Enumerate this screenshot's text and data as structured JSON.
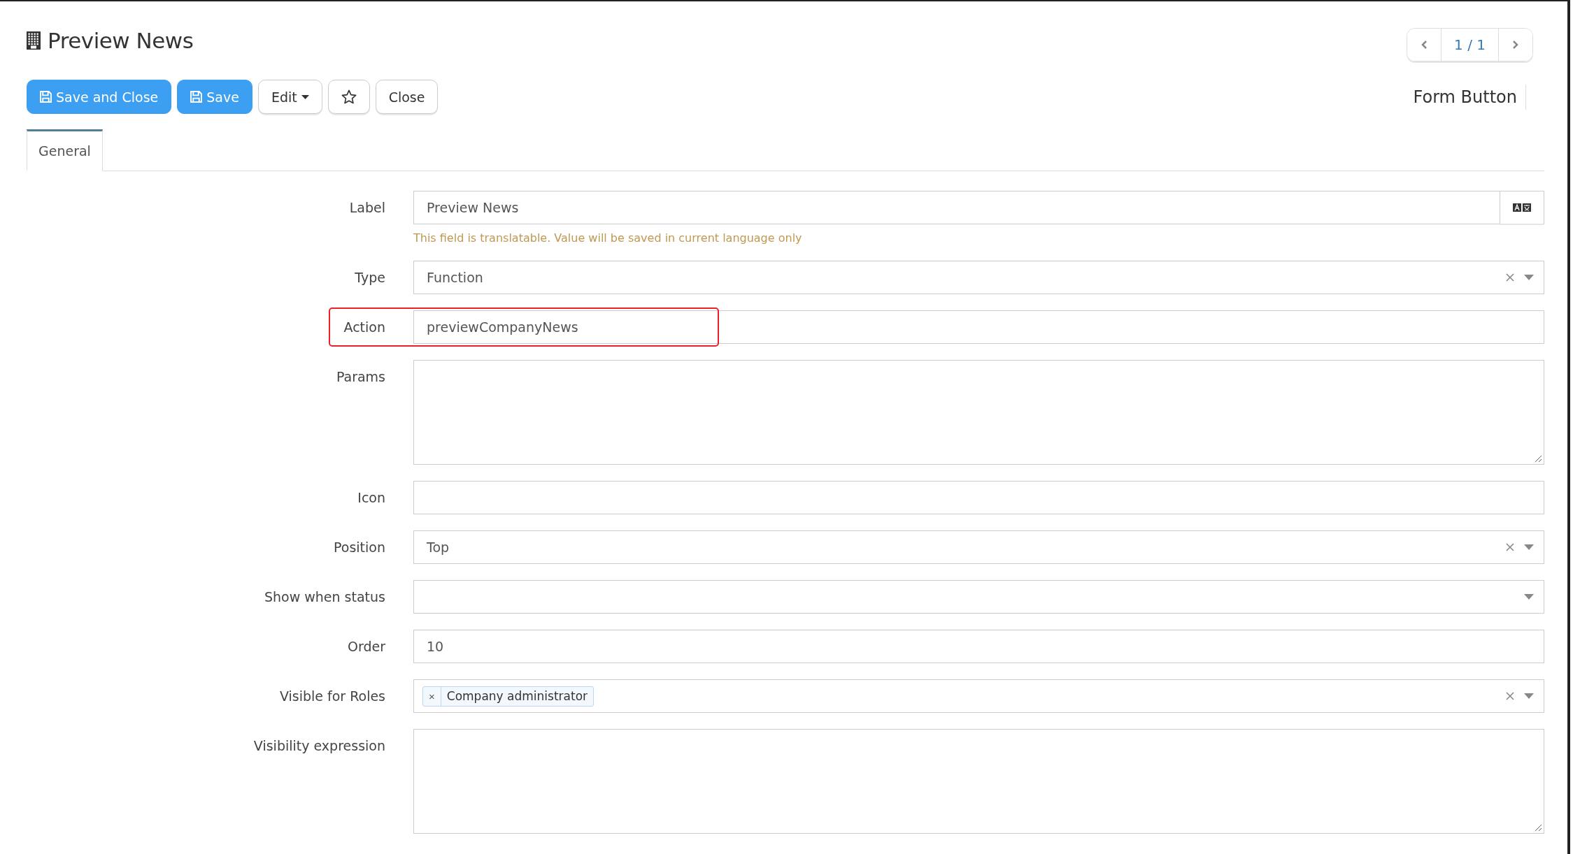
{
  "title": "Preview News",
  "pager": {
    "text": "1 / 1"
  },
  "toolbar": [
    {
      "label": "Save and Close",
      "kind": "primary"
    },
    {
      "label": "Save",
      "kind": "primary"
    },
    {
      "label": "Edit",
      "kind": "dropdown"
    },
    {
      "kind": "star"
    },
    {
      "label": "Close",
      "kind": "default"
    }
  ],
  "model_name": "Form Button",
  "tabs": [
    {
      "label": "General",
      "selected": true
    }
  ],
  "fields": [
    {
      "label": "Label",
      "kind": "text",
      "value": "Preview News",
      "translatable": true,
      "help": "This field is translatable. Value will be saved in current language only",
      "highlighted": false
    },
    {
      "label": "Type",
      "kind": "select",
      "value": "Function",
      "highlighted": false
    },
    {
      "label": "Action",
      "kind": "text",
      "value": "previewCompanyNews",
      "highlighted": true
    },
    {
      "label": "Params",
      "kind": "textarea",
      "highlighted": false
    },
    {
      "label": "Icon",
      "kind": "text",
      "highlighted": false
    },
    {
      "label": "Position",
      "kind": "select",
      "value": "Top",
      "highlighted": false
    },
    {
      "label": "Show when status",
      "kind": "select",
      "highlighted": false
    },
    {
      "label": "Order",
      "kind": "text",
      "value": "10",
      "highlighted": false
    },
    {
      "label": "Visible for Roles",
      "kind": "tags",
      "tags": [
        {
          "remove": "×",
          "text": "Company administrator"
        }
      ],
      "highlighted": false
    },
    {
      "label": "Visibility expression",
      "kind": "textarea",
      "highlighted": false
    }
  ]
}
